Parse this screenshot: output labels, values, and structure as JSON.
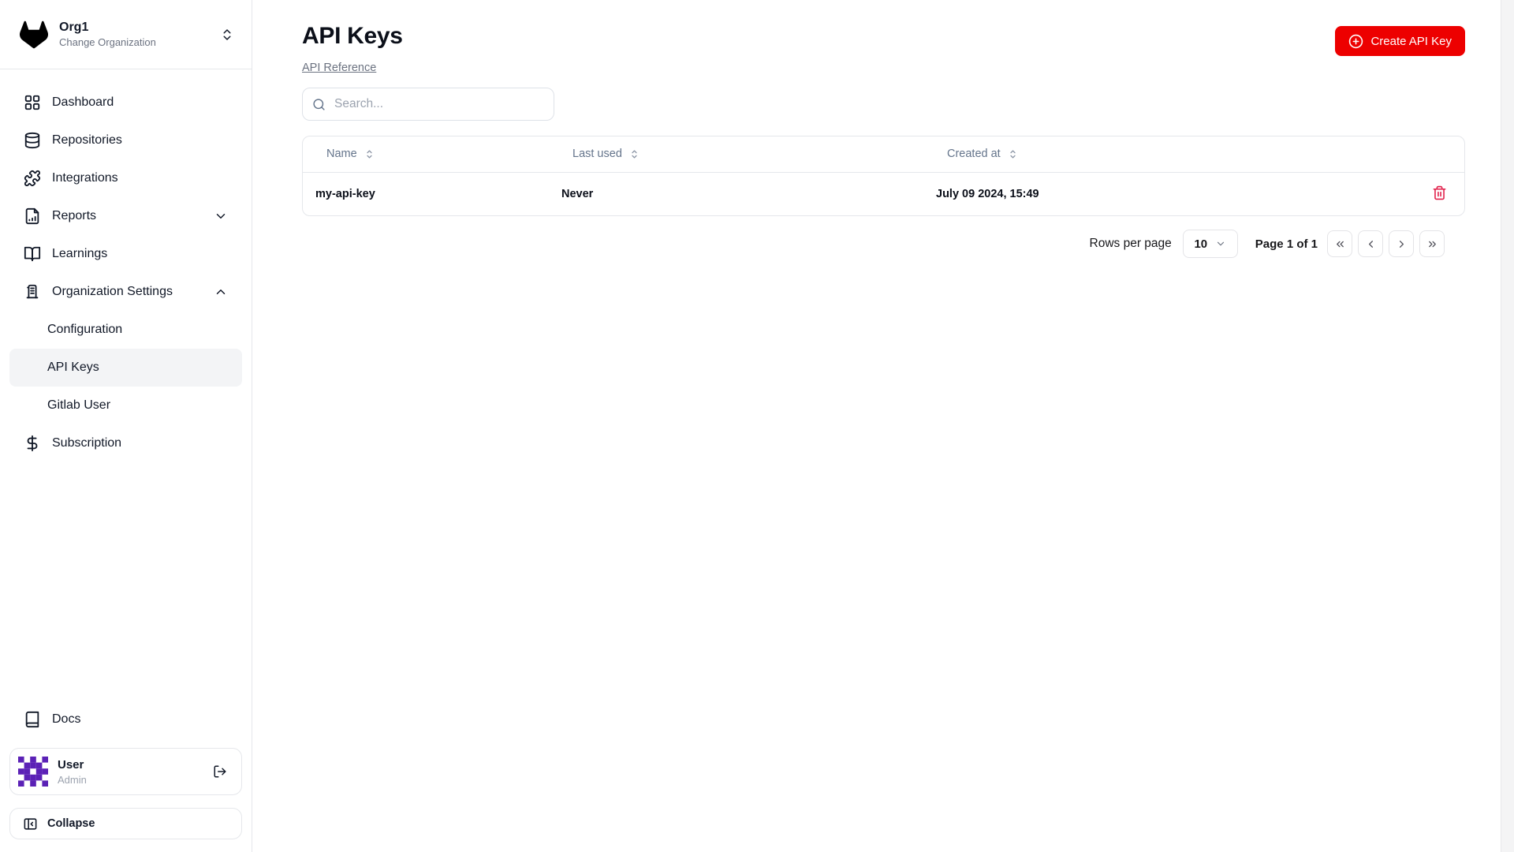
{
  "org": {
    "name": "Org1",
    "subtitle": "Change Organization"
  },
  "sidebar": {
    "items": [
      {
        "label": "Dashboard",
        "icon": "layout-grid-icon"
      },
      {
        "label": "Repositories",
        "icon": "database-icon"
      },
      {
        "label": "Integrations",
        "icon": "puzzle-icon"
      },
      {
        "label": "Reports",
        "icon": "file-chart-icon",
        "chevron": "down"
      },
      {
        "label": "Learnings",
        "icon": "book-open-icon"
      },
      {
        "label": "Organization Settings",
        "icon": "building-icon",
        "chevron": "up"
      },
      {
        "label": "Configuration"
      },
      {
        "label": "API Keys",
        "active": true
      },
      {
        "label": "Gitlab User"
      },
      {
        "label": "Subscription",
        "icon": "dollar-icon"
      }
    ],
    "docs_label": "Docs",
    "user": {
      "name": "User",
      "role": "Admin"
    },
    "collapse_label": "Collapse"
  },
  "main": {
    "title": "API Keys",
    "reference_link_label": "API Reference",
    "search_placeholder": "Search...",
    "create_button_label": "Create API Key",
    "table": {
      "columns": [
        "Name",
        "Last used",
        "Created at"
      ],
      "rows": [
        {
          "name": "my-api-key",
          "last_used": "Never",
          "created_at": "July 09 2024, 15:49"
        }
      ]
    },
    "pagination": {
      "rows_per_page_label": "Rows per page",
      "rows_per_page_value": "10",
      "page_status": "Page 1 of 1"
    }
  },
  "colors": {
    "accent_red": "#ed0000",
    "danger_rose": "#e11d48",
    "avatar_purple": "#5b21b6",
    "border": "#e5e7eb",
    "active_item_bg": "#f3f4f6"
  }
}
